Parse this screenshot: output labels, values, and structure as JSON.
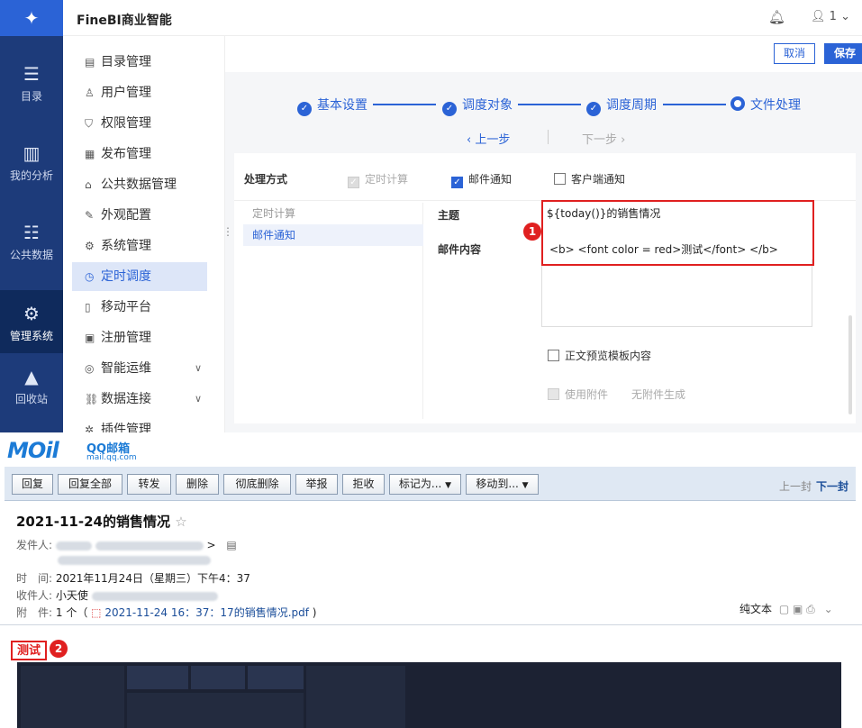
{
  "app": {
    "title": "FineBI商业智能",
    "user": "1"
  },
  "rail": [
    {
      "label": "目录",
      "icon": "catalog-icon"
    },
    {
      "label": "我的分析",
      "icon": "analysis-icon"
    },
    {
      "label": "公共数据",
      "icon": "database-icon"
    },
    {
      "label": "管理系统",
      "icon": "gear-icon"
    },
    {
      "label": "回收站",
      "icon": "recycle-icon"
    }
  ],
  "menu": [
    {
      "label": "目录管理"
    },
    {
      "label": "用户管理"
    },
    {
      "label": "权限管理"
    },
    {
      "label": "发布管理"
    },
    {
      "label": "公共数据管理"
    },
    {
      "label": "外观配置"
    },
    {
      "label": "系统管理"
    },
    {
      "label": "定时调度"
    },
    {
      "label": "移动平台"
    },
    {
      "label": "注册管理"
    },
    {
      "label": "智能运维"
    },
    {
      "label": "数据连接"
    },
    {
      "label": "插件管理"
    }
  ],
  "actions": {
    "cancel": "取消",
    "save": "保存"
  },
  "steps": [
    {
      "label": "基本设置"
    },
    {
      "label": "调度对象"
    },
    {
      "label": "调度周期"
    },
    {
      "label": "文件处理"
    }
  ],
  "nav": {
    "prev": "上一步",
    "next": "下一步"
  },
  "processing": {
    "label": "处理方式",
    "options": [
      {
        "label": "定时计算",
        "checked": true,
        "disabled": true
      },
      {
        "label": "邮件通知",
        "checked": true,
        "disabled": false
      },
      {
        "label": "客户端通知",
        "checked": false,
        "disabled": false
      }
    ],
    "sub_items": [
      {
        "label": "定时计算"
      },
      {
        "label": "邮件通知"
      }
    ]
  },
  "email": {
    "subject_label": "主题",
    "subject_value": "${today()}的销售情况",
    "content_label": "邮件内容",
    "content_value": "<b> <font color = red>测试</font> </b>",
    "preview_template": "正文预览模板内容",
    "use_attachment": "使用附件",
    "no_attachment": "无附件生成"
  },
  "annotations": {
    "one": "1",
    "two": "2"
  },
  "mail": {
    "logo": "MOil",
    "logo_cn": "QQ邮箱",
    "logo_url": "mail.qq.com",
    "toolbar": [
      "回复",
      "回复全部",
      "转发",
      "删除",
      "彻底删除",
      "举报",
      "拒收",
      "标记为...",
      "移动到..."
    ],
    "prev": "上一封",
    "next": "下一封",
    "subject": "2021-11-24的销售情况",
    "from_label": "发件人:",
    "time_label": "时　间:",
    "time_value": "2021年11月24日（星期三）下午4：37",
    "to_label": "收件人:",
    "to_value": "小天使",
    "attach_label": "附　件:",
    "attach_count": "1 个（",
    "attach_file": "2021-11-24 16：37：17的销售情况.pdf",
    "attach_close": ")",
    "plain_text": "纯文本",
    "body_text": "测试"
  }
}
